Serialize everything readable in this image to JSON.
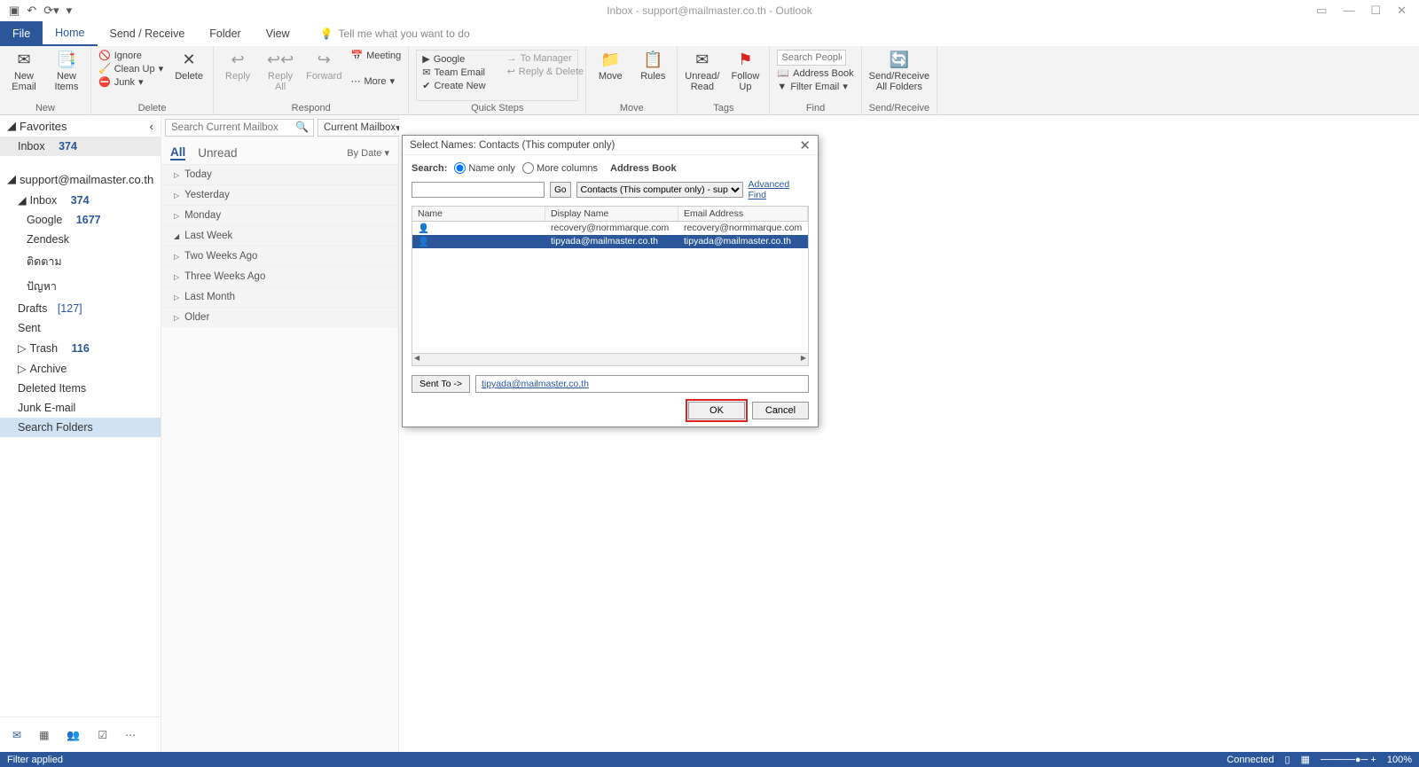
{
  "window": {
    "title": "Inbox - support@mailmaster.co.th - Outlook"
  },
  "tabs": {
    "file": "File",
    "home": "Home",
    "send_receive": "Send / Receive",
    "folder": "Folder",
    "view": "View",
    "tell_me": "Tell me what you want to do"
  },
  "ribbon": {
    "new": {
      "new_email": "New\nEmail",
      "new_items": "New\nItems",
      "label": "New"
    },
    "delete": {
      "ignore": "Ignore",
      "clean_up": "Clean Up",
      "junk": "Junk",
      "delete": "Delete",
      "label": "Delete"
    },
    "respond": {
      "reply": "Reply",
      "reply_all": "Reply\nAll",
      "forward": "Forward",
      "meeting": "Meeting",
      "more": "More",
      "label": "Respond"
    },
    "quick_steps": {
      "google": "Google",
      "team_email": "Team Email",
      "create_new": "Create New",
      "to_manager": "To Manager",
      "reply_delete": "Reply & Delete",
      "label": "Quick Steps"
    },
    "move": {
      "move": "Move",
      "rules": "Rules",
      "label": "Move"
    },
    "tags": {
      "unread_read": "Unread/\nRead",
      "follow_up": "Follow\nUp",
      "label": "Tags"
    },
    "find": {
      "search_placeholder": "Search People",
      "address_book": "Address Book",
      "filter_email": "Filter Email",
      "label": "Find"
    },
    "sr": {
      "btn": "Send/Receive\nAll Folders",
      "label": "Send/Receive"
    }
  },
  "folders": {
    "favorites": "Favorites",
    "inbox": "Inbox",
    "inbox_count": "374",
    "account": "support@mailmaster.co.th",
    "google": "Google",
    "google_count": "1677",
    "zendesk": "Zendesk",
    "th1": "ติดตาม",
    "th2": "ปัญหา",
    "drafts": "Drafts",
    "drafts_count": "[127]",
    "sent": "Sent",
    "trash": "Trash",
    "trash_count": "116",
    "archive": "Archive",
    "deleted": "Deleted Items",
    "junk": "Junk E-mail",
    "search_folders": "Search Folders"
  },
  "msg_list": {
    "search_placeholder": "Search Current Mailbox",
    "scope": "Current Mailbox",
    "all": "All",
    "unread": "Unread",
    "by_date": "By Date",
    "groups": [
      "Today",
      "Yesterday",
      "Monday",
      "Last Week",
      "Two Weeks Ago",
      "Three Weeks Ago",
      "Last Month",
      "Older"
    ]
  },
  "dialog": {
    "title": "Select Names: Contacts (This computer only)",
    "search_label": "Search:",
    "name_only": "Name only",
    "more_columns": "More columns",
    "address_book_label": "Address Book",
    "go": "Go",
    "ab_select": "Contacts (This computer only) - support@m",
    "advanced_find": "Advanced Find",
    "col_name": "Name",
    "col_display": "Display Name",
    "col_email": "Email Address",
    "rows": [
      {
        "name": "",
        "display": "recovery@normmarque.com",
        "email": "recovery@normmarque.com",
        "selected": false
      },
      {
        "name": "",
        "display": "tipyada@mailmaster.co.th",
        "email": "tipyada@mailmaster.co.th",
        "selected": true
      }
    ],
    "sent_to_btn": "Sent To ->",
    "sent_to_value": "tipyada@mailmaster.co.th",
    "ok": "OK",
    "cancel": "Cancel"
  },
  "statusbar": {
    "left": "Filter applied",
    "connected": "Connected",
    "zoom": "100%"
  }
}
